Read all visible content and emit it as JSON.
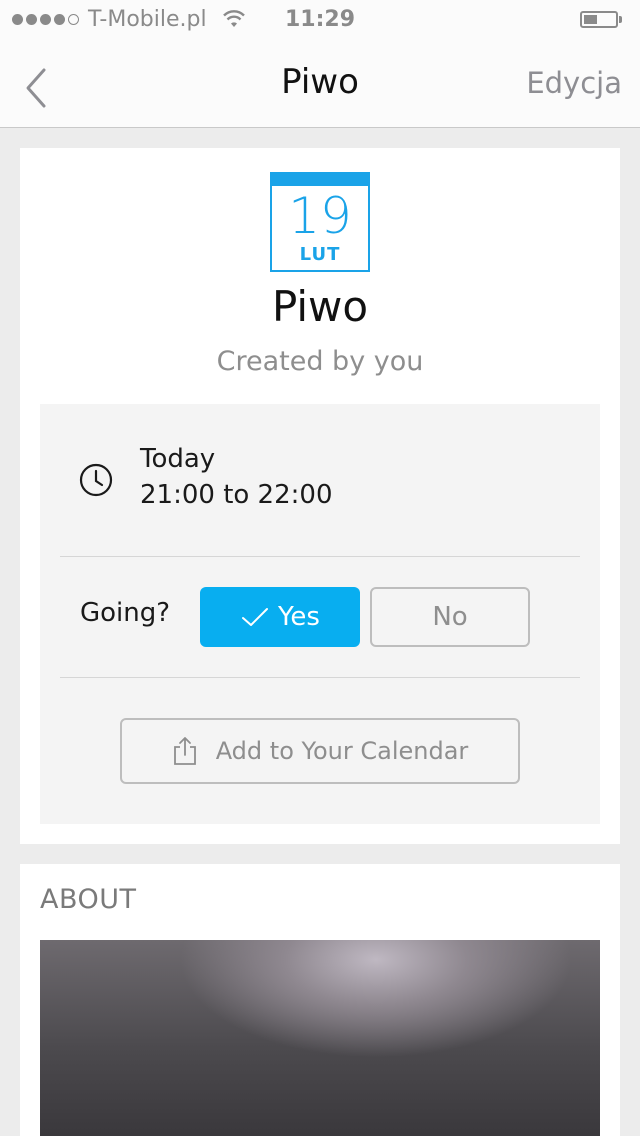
{
  "status_bar": {
    "carrier": "T-Mobile.pl",
    "time": "11:29",
    "signal_icon": "signal-dots-icon",
    "wifi_icon": "wifi-icon",
    "battery_icon": "battery-icon"
  },
  "nav": {
    "title": "Piwo",
    "edit_label": "Edycja",
    "back_icon": "chevron-left-icon"
  },
  "event": {
    "calendar_day": "19",
    "calendar_month": "LUT",
    "title": "Piwo",
    "created_by": "Created by you",
    "date": "Today",
    "time_range": "21:00 to 22:00",
    "going_label": "Going?",
    "yes_label": "Yes",
    "no_label": "No",
    "add_calendar_label": "Add to Your Calendar"
  },
  "about": {
    "title": "ABOUT"
  },
  "colors": {
    "accent": "#08aef0",
    "calendar_blue": "#1aa3e8",
    "muted_text": "#8e8e8e",
    "background": "#ececec"
  }
}
